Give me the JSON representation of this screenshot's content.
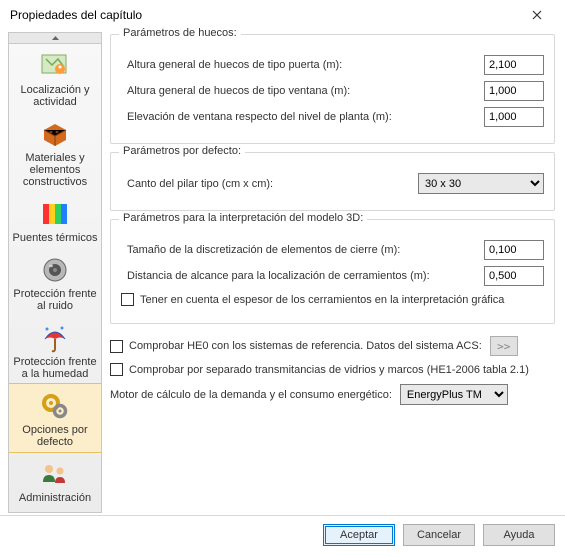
{
  "title": "Propiedades del capítulo",
  "sidebar": {
    "items": [
      {
        "label": "Localización y actividad"
      },
      {
        "label": "Materiales y elementos constructivos"
      },
      {
        "label": "Puentes térmicos"
      },
      {
        "label": "Protección frente al ruido"
      },
      {
        "label": "Protección frente a la humedad"
      },
      {
        "label": "Opciones por defecto"
      },
      {
        "label": "Administración"
      }
    ]
  },
  "group_huecos": {
    "title": "Parámetros de huecos:",
    "altura_puerta_label": "Altura general de huecos de tipo puerta (m):",
    "altura_puerta_value": "2,100",
    "altura_ventana_label": "Altura general de huecos de tipo ventana (m):",
    "altura_ventana_value": "1,000",
    "elevacion_label": "Elevación de ventana respecto del nivel de planta (m):",
    "elevacion_value": "1,000"
  },
  "group_defecto": {
    "title": "Parámetros por defecto:",
    "canto_label": "Canto del pilar tipo (cm x cm):",
    "canto_value": "30 x 30"
  },
  "group_3d": {
    "title": "Parámetros para la interpretación del modelo 3D:",
    "tamano_label": "Tamaño de la discretización de elementos de cierre (m):",
    "tamano_value": "0,100",
    "distancia_label": "Distancia de alcance para la localización de cerramientos (m):",
    "distancia_value": "0,500",
    "espesor_label": "Tener en cuenta el espesor de los cerramientos en la interpretación gráfica"
  },
  "he0_check": "Comprobar HE0 con los sistemas de referencia. Datos del sistema ACS:",
  "he0_btn": ">>",
  "he1_check": "Comprobar por separado transmitancias de vidrios y marcos (HE1-2006 tabla 2.1)",
  "motor_label": "Motor de cálculo de la demanda y el consumo energético:",
  "motor_value": "EnergyPlus TM",
  "buttons": {
    "accept": "Aceptar",
    "cancel": "Cancelar",
    "help": "Ayuda"
  }
}
